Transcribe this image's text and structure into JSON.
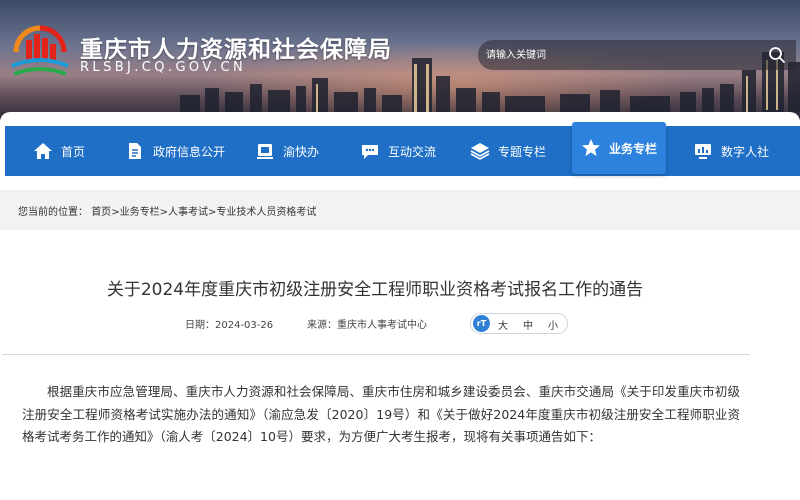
{
  "header": {
    "site_title": "重庆市人力资源和社会保障局",
    "site_domain": "RLSBJ.CQ.GOV.CN",
    "search_placeholder": "请输入关键词"
  },
  "nav": {
    "items": [
      {
        "label": "首页",
        "icon": "home-icon"
      },
      {
        "label": "政府信息公开",
        "icon": "document-icon"
      },
      {
        "label": "渝快办",
        "icon": "service-icon"
      },
      {
        "label": "互动交流",
        "icon": "chat-icon"
      },
      {
        "label": "专题专栏",
        "icon": "layers-icon"
      },
      {
        "label": "业务专栏",
        "icon": "star-icon",
        "active": true
      },
      {
        "label": "数字人社",
        "icon": "monitor-icon"
      }
    ]
  },
  "breadcrumb": {
    "prefix": "您当前的位置：",
    "items": [
      "首页",
      "业务专栏",
      "人事考试",
      "专业技术人员资格考试"
    ],
    "separator": ">"
  },
  "article": {
    "title": "关于2024年度重庆市初级注册安全工程师职业资格考试报名工作的通告",
    "date_label": "日期：",
    "date": "2024-03-26",
    "source_label": "来源：",
    "source": "重庆市人事考试中心",
    "font_size_options": [
      "大",
      "中",
      "小"
    ],
    "body": "根据重庆市应急管理局、重庆市人力资源和社会保障局、重庆市住房和城乡建设委员会、重庆市交通局《关于印发重庆市初级注册安全工程师资格考试实施办法的通知》（渝应急发〔2020〕19号）和《关于做好2024年度重庆市初级注册安全工程师职业资格考试考务工作的通知》（渝人考〔2024〕10号）要求，为方便广大考生报考，现将有关事项通告如下："
  },
  "colors": {
    "nav_blue": "#1f6fc6",
    "nav_active": "#2d82dd"
  }
}
